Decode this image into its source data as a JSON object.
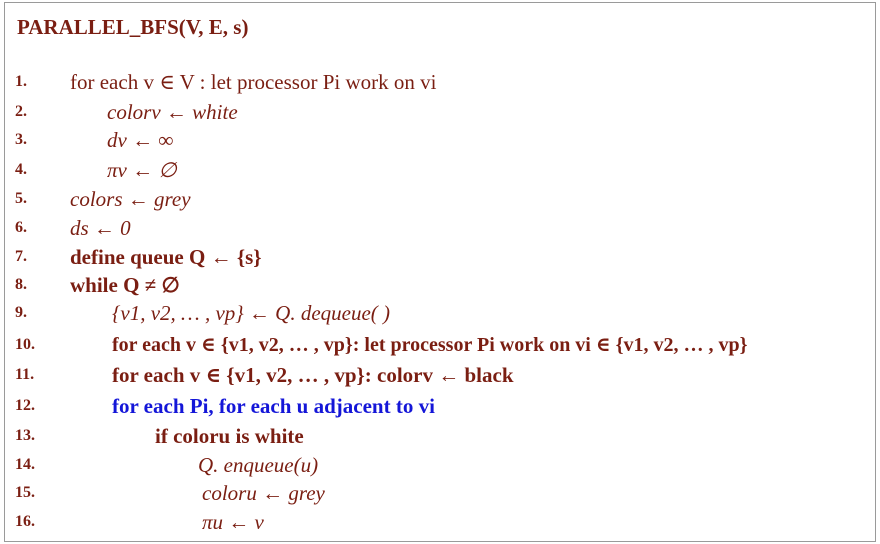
{
  "title": "PARALLEL_BFS(V, E, s)",
  "lines": [
    {
      "n": "1.",
      "text": "for each v ∈ V : let processor Pi work on vi"
    },
    {
      "n": "2.",
      "text": "colorv ← white"
    },
    {
      "n": "3.",
      "text": "dv ← ∞"
    },
    {
      "n": "4.",
      "text": "πv ← ∅"
    },
    {
      "n": "5.",
      "text": "colors ← grey"
    },
    {
      "n": "6.",
      "text": "ds ← 0"
    },
    {
      "n": "7.",
      "text": "define queue Q ← {s}"
    },
    {
      "n": "8.",
      "text": "while Q ≠ ∅"
    },
    {
      "n": "9.",
      "text": "{v1, v2, … , vp} ← Q. dequeue( )"
    },
    {
      "n": "10.",
      "text": "for each v ∈ {v1, v2, … , vp}: let processor Pi work on vi ∈ {v1, v2, … , vp}"
    },
    {
      "n": "11.",
      "text": "for each v ∈ {v1, v2, … , vp}: colorv ← black"
    },
    {
      "n": "12.",
      "text": "for each Pi, for each u adjacent to vi"
    },
    {
      "n": "13.",
      "text": "if coloru is white"
    },
    {
      "n": "14.",
      "text": "Q. enqueue(u)"
    },
    {
      "n": "15.",
      "text": "coloru ← grey"
    },
    {
      "n": "16.",
      "text": "πu ← v"
    }
  ],
  "colors": {
    "text": "#7a1e12",
    "accent": "#1416d8",
    "border": "#9a9a9a"
  }
}
